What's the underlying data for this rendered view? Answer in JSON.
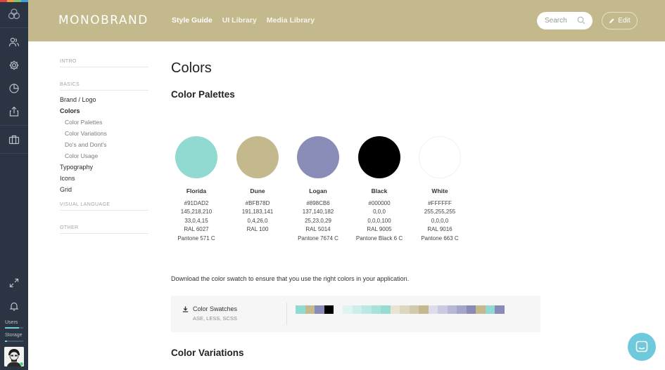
{
  "rail": {
    "top_strip_colors": [
      "#d44",
      "#e9a23b",
      "#7cc56a",
      "#3aa0e0"
    ],
    "items": [
      {
        "name": "users-icon"
      },
      {
        "name": "gear-icon"
      },
      {
        "name": "pie-chart-icon"
      },
      {
        "name": "share-icon"
      },
      {
        "name": "briefcase-icon"
      }
    ],
    "bottom": {
      "expand_icon": "expand-icon",
      "bell_icon": "bell-icon",
      "users_label": "Users",
      "users_fill": 0.75,
      "storage_label": "Storage",
      "storage_fill": 0.1
    }
  },
  "header": {
    "brand": "MONOBRAND",
    "nav": [
      "Style Guide",
      "UI Library",
      "Media Library"
    ],
    "search_placeholder": "Search",
    "edit_label": "Edit",
    "bg_color": "#c3b98c"
  },
  "sidenav": {
    "intro": "INTRO",
    "basics": "BASICS",
    "items": {
      "brand_logo": "Brand / Logo",
      "colors": "Colors",
      "color_palettes": "Color Palettes",
      "color_variations": "Color Variations",
      "dos_donts": "Do's and Dont's",
      "color_usage": "Color Usage",
      "typography": "Typography",
      "icons": "Icons",
      "grid": "Grid"
    },
    "visual_language": "VISUAL LANGUAGE",
    "other": "OTHER"
  },
  "main": {
    "title": "Colors",
    "palettes_title": "Color Palettes",
    "colors": [
      {
        "name": "Florida",
        "hex": "#91DAD2",
        "rgb": "145,218,210",
        "cmyk": "33,0,4,15",
        "ral": "RAL 6027",
        "pantone": "Pantone 571 C",
        "swatch": "#91dad2"
      },
      {
        "name": "Dune",
        "hex": "#BFB78D",
        "rgb": "191,183,141",
        "cmyk": "0,4,26,0",
        "ral": "RAL 100",
        "pantone": "",
        "swatch": "#c3b98c"
      },
      {
        "name": "Logan",
        "hex": "#898CB6",
        "rgb": "137,140,182",
        "cmyk": "25,23,0,29",
        "ral": "RAL 5014",
        "pantone": "Pantone 7674 C",
        "swatch": "#898cb6"
      },
      {
        "name": "Black",
        "hex": "#000000",
        "rgb": "0,0,0",
        "cmyk": "0,0,0,100",
        "ral": "RAL 9005",
        "pantone": "Pantone Black 6 C",
        "swatch": "#000000"
      },
      {
        "name": "White",
        "hex": "#FFFFFF",
        "rgb": "255,255,255",
        "cmyk": "0,0,0,0",
        "ral": "RAL 9016",
        "pantone": "Pantone 663 C",
        "swatch": "#ffffff"
      }
    ],
    "download_text": "Download the color swatch to ensure that you use the right colors in your application.",
    "swatch_download": {
      "label": "Color Swatches",
      "formats": "ASE, LESS, SCSS",
      "chips_primary": [
        "#91dad2",
        "#c3b98c",
        "#898cb6",
        "#000000"
      ],
      "chips_variations": [
        "#dff3f1",
        "#cdeeea",
        "#bbe8e3",
        "#a8e2db",
        "#96dcd3",
        "#e8e4d2",
        "#ddd7bf",
        "#d1cbab",
        "#c3b98c",
        "#dcdcec",
        "#c9cae0",
        "#b6b8d5",
        "#a3a5c9",
        "#898cb6",
        "#c3b98c",
        "#91dad2",
        "#898cb6"
      ]
    },
    "variations_title": "Color Variations"
  }
}
